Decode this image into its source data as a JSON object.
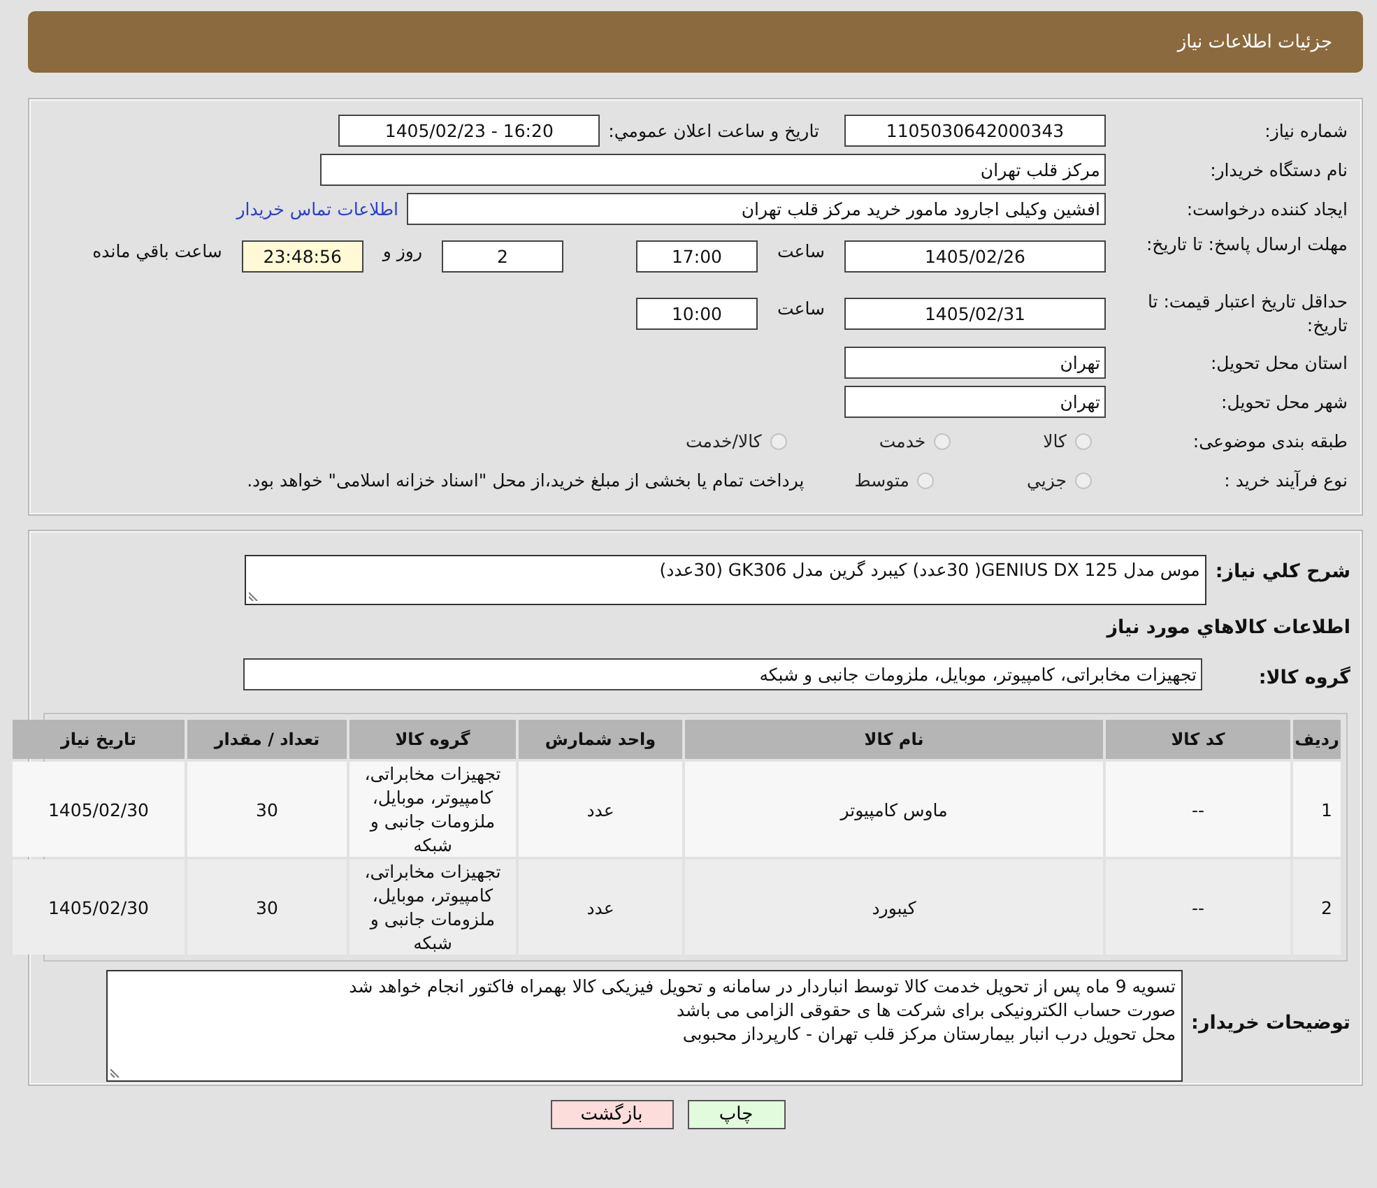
{
  "header": {
    "title": "جزئیات اطلاعات نیاز"
  },
  "need_number": {
    "label": "شماره نیاز:",
    "value": "1105030642000343"
  },
  "announce": {
    "label": "تاريخ و ساعت اعلان عمومي:",
    "value": "1405/02/23 - 16:20"
  },
  "buyer_org": {
    "label": "نام دستگاه خریدار:",
    "value": "مرکز قلب تهران"
  },
  "requester": {
    "label": "ایجاد کننده درخواست:",
    "value": "افشین وکیلی اجارود مامور خرید مرکز قلب تهران",
    "link": "اطلاعات تماس خریدار"
  },
  "reply_deadline": {
    "label": "مهلت ارسال پاسخ: تا تاریخ:",
    "date": "1405/02/26",
    "time_label": "ساعت",
    "time": "17:00",
    "days": "2",
    "days_label": "روز و",
    "remaining": "23:48:56",
    "remaining_label": "ساعت باقي مانده"
  },
  "price_validity": {
    "label": "حداقل تاریخ اعتبار قیمت: تا تاریخ:",
    "date": "1405/02/31",
    "time_label": "ساعت",
    "time": "10:00"
  },
  "province": {
    "label": "استان محل تحویل:",
    "value": "تهران"
  },
  "city": {
    "label": "شهر محل تحویل:",
    "value": "تهران"
  },
  "category": {
    "label": "طبقه بندی موضوعی:",
    "options": [
      {
        "label": "كالا",
        "selected": false
      },
      {
        "label": "خدمت",
        "selected": false
      },
      {
        "label": "كالا/خدمت",
        "selected": false
      }
    ]
  },
  "process": {
    "label": "نوع فرآیند خرید :",
    "options": [
      {
        "label": "جزيي",
        "selected": false
      },
      {
        "label": "متوسط",
        "selected": false
      }
    ],
    "note": "پرداخت تمام یا بخشی از مبلغ خرید،از محل \"اسناد خزانه اسلامی\" خواهد بود."
  },
  "description": {
    "label": "شرح كلي نياز:",
    "value": "موس مدل GENIUS DX 125( 30عدد)  کیبرد گرین مدل GK306 (30عدد)"
  },
  "goods_heading": "اطلاعات كالاهاي مورد نياز",
  "goods_group": {
    "label": "گروه کالا:",
    "value": "تجهیزات مخابراتی، کامپیوتر، موبایل، ملزومات جانبی و شبکه"
  },
  "table": {
    "columns": [
      "رديف",
      "كد كالا",
      "نام كالا",
      "واحد شمارش",
      "گروه كالا",
      "تعداد / مقدار",
      "تاريخ نياز"
    ],
    "rows": [
      {
        "cells": [
          "1",
          "--",
          "ماوس کامپیوتر",
          "عدد",
          "تجهیزات مخابراتی، کامپیوتر، موبایل، ملزومات جانبی و شبکه",
          "30",
          "1405/02/30"
        ]
      },
      {
        "cells": [
          "2",
          "--",
          "کیبورد",
          "عدد",
          "تجهیزات مخابراتی، کامپیوتر، موبایل، ملزومات جانبی و شبکه",
          "30",
          "1405/02/30"
        ]
      }
    ]
  },
  "buyer_notes": {
    "label": "توضیحات خریدار:",
    "lines": [
      "تسویه 9 ماه پس از تحویل خدمت کالا توسط انباردار در سامانه و تحویل فیزیکی کالا بهمراه فاکتور انجام خواهد شد",
      "صورت حساب الکترونیکی برای شرکت ها ی حقوقی الزامی می باشد",
      "محل تحویل درب انبار بیمارستان مرکز قلب تهران - کارپرداز محبوبی"
    ]
  },
  "buttons": [
    {
      "label": "چاپ",
      "kind": "print"
    },
    {
      "label": "بازگشت",
      "kind": "back"
    }
  ]
}
